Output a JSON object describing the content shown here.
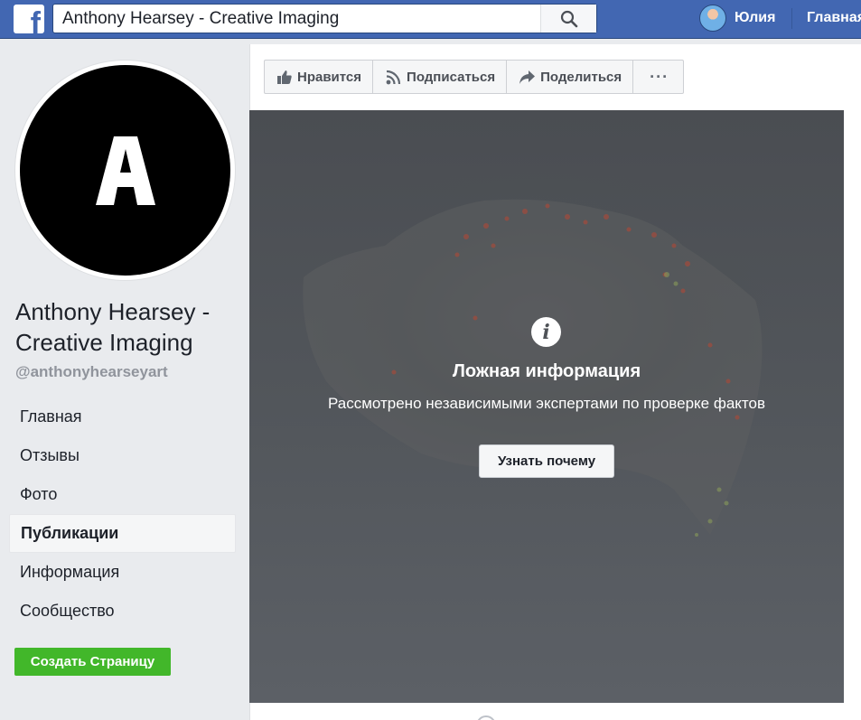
{
  "topbar": {
    "logo_letter": "f",
    "search_value": "Anthony Hearsey - Creative Imaging",
    "user_name": "Юлия",
    "home_link": "Главная"
  },
  "profile": {
    "initial": "A",
    "name": "Anthony Hearsey - Creative Imaging",
    "handle": "@anthonyhearseyart"
  },
  "nav": {
    "items": [
      {
        "label": "Главная"
      },
      {
        "label": "Отзывы"
      },
      {
        "label": "Фото"
      },
      {
        "label": "Публикации",
        "active": true
      },
      {
        "label": "Информация"
      },
      {
        "label": "Сообщество"
      }
    ]
  },
  "create_page_label": "Создать Страницу",
  "actions": {
    "like": "Нравится",
    "follow": "Подписаться",
    "share": "Поделиться",
    "more": "···"
  },
  "post": {
    "warning_title": "Ложная информация",
    "warning_subtitle": "Рассмотрено независимыми экспертами по проверке фактов",
    "learn_button": "Узнать почему"
  },
  "colors": {
    "brand": "#4267b2",
    "create_button": "#42b72a",
    "background": "#e9ebee"
  }
}
